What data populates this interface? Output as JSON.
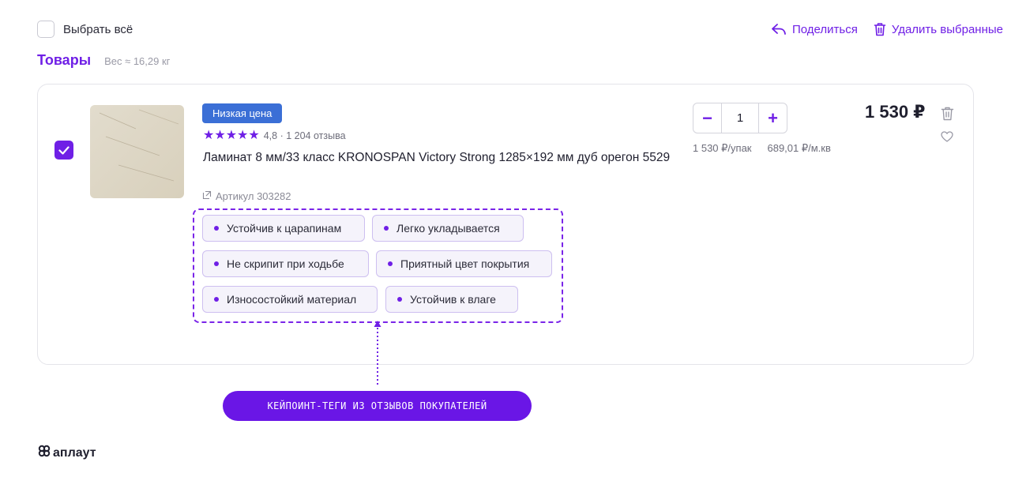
{
  "header": {
    "select_all_label": "Выбрать всё",
    "share_label": "Поделиться",
    "delete_selected_label": "Удалить выбранные"
  },
  "section": {
    "title": "Товары",
    "weight": "Вес ≈ 16,29 кг"
  },
  "product": {
    "selected": true,
    "badge": "Низкая цена",
    "stars": "★★★★★",
    "rating": 4.8,
    "rating_text": "4,8 · 1 204 отзыва",
    "name": "Ламинат 8 мм/33 класс KRONOSPAN Victory Strong 1285×192 мм дуб орегон 5529",
    "article": "Артикул 303282",
    "tags": [
      "Устойчив к царапинам",
      "Легко укладывается",
      "Не скрипит при ходьбе",
      "Приятный цвет покрытия",
      "Износостойкий материал",
      "Устойчив к влаге"
    ],
    "quantity": "1",
    "minus": "−",
    "plus": "+",
    "price_per_pack": "1 530 ₽/упак",
    "price_per_sqm": "689,01 ₽/м.кв",
    "price": "1 530 ₽"
  },
  "annotation": {
    "label": "КЕЙПОИНТ-ТЕГИ ИЗ ОТЗЫВОВ ПОКУПАТЕЛЕЙ"
  },
  "brand": {
    "name": "аплаут"
  },
  "colors": {
    "accent": "#6f1fe6",
    "badge": "#3b6fd6",
    "tag_bg": "#f5f3fb"
  }
}
